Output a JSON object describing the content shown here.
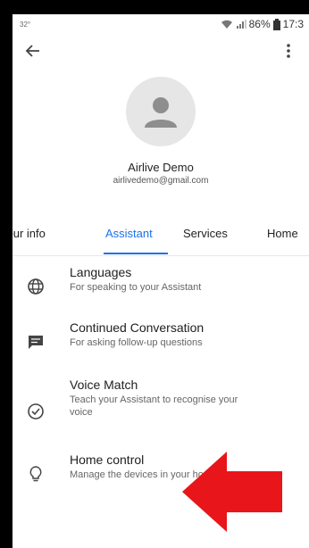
{
  "status_bar": {
    "left": "32°",
    "battery": "86%",
    "time": "17:3"
  },
  "profile": {
    "name": "Airlive Demo",
    "email": "airlivedemo@gmail.com"
  },
  "tabs": [
    {
      "label": "Your info"
    },
    {
      "label": "Assistant"
    },
    {
      "label": "Services"
    },
    {
      "label": "Home"
    }
  ],
  "active_tab": "Assistant",
  "settings": [
    {
      "title": "Languages",
      "subtitle": "For speaking to your Assistant",
      "icon": "globe-icon"
    },
    {
      "title": "Continued Conversation",
      "subtitle": "For asking follow-up questions",
      "icon": "chat-icon"
    },
    {
      "title": "Voice Match",
      "subtitle": "Teach your Assistant to recognise your voice",
      "icon": "voice-match-icon"
    },
    {
      "title": "Home control",
      "subtitle": "Manage the devices in your home",
      "icon": "lightbulb-icon"
    }
  ],
  "colors": {
    "accent": "#1a73e8",
    "annotation_arrow": "#e8161a"
  }
}
